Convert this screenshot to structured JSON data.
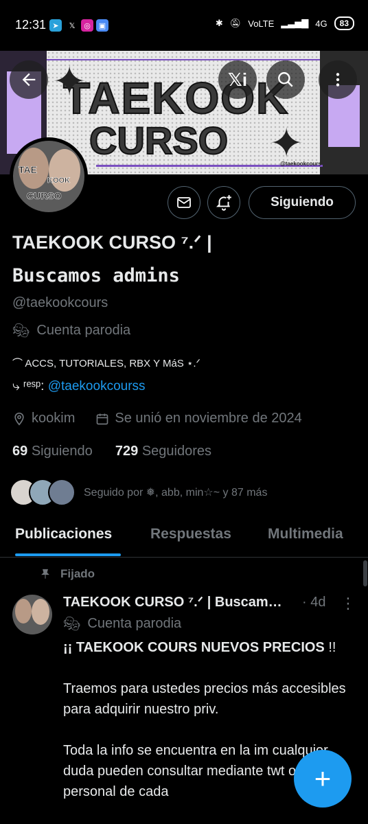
{
  "status_bar": {
    "time": "12:31",
    "network": "VoLTE",
    "signal": "4G",
    "battery": "83"
  },
  "banner": {
    "title_line1": "TAEKOOK",
    "title_line2": "CURSO",
    "handle": "@taekookcours"
  },
  "header_icons": [
    "back-arrow-icon",
    "xi-logo-icon",
    "search-icon",
    "more-icon"
  ],
  "avatar": {
    "text_top": "TAE",
    "text_mid": "KOOK",
    "text_bottom": "CURSO"
  },
  "actions": {
    "follow_label": "Siguiendo"
  },
  "profile": {
    "name": "TAEKOOK CURSO ⁷.ᐟ |",
    "name_line2": "Buscamos admins",
    "handle": "@taekookcours",
    "parody_label": "Cuenta parodia",
    "bio_line1": "⌒  ACCS, TUTORIALES, RBX Y MáS      ⋆.ᐟ",
    "bio_line2_prefix": "⤷ ʳᵉˢᵖ: ",
    "bio_line2_link": "@taekookcourss",
    "location": "kookim",
    "joined": "Se unió en noviembre de 2024",
    "following_count": "69",
    "following_label": "Siguiendo",
    "followers_count": "729",
    "followers_label": "Seguidores",
    "followed_by": "Seguido por ❅, abb, min☆~ y 87 más"
  },
  "tabs": [
    "Publicaciones",
    "Respuestas",
    "Multimedia"
  ],
  "post": {
    "pinned_label": "Fijado",
    "author": "TAEKOOK CURSO ⁷.ᐟ | Buscam…",
    "time": "· 4d",
    "parody_label": "Cuenta parodia",
    "headline": "¡¡ TAEKOOK COURS NUEVOS PRECIOS",
    "headline_end": " !!",
    "paragraph1": "Traemos para ustedes precios más accesibles para adquirir nuestro priv.",
    "paragraph2": "Toda la info se encuentra en la im cualquier duda pueden consultar mediante twt o el tlg personal de cada"
  },
  "fab_label": "+",
  "colors": {
    "accent": "#1d9bf0",
    "muted": "#71767b",
    "background": "#000000"
  }
}
